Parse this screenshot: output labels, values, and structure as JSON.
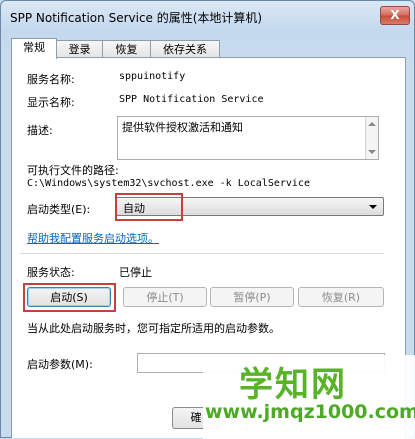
{
  "window": {
    "title": "SPP Notification Service 的属性(本地计算机)",
    "close_label": "X"
  },
  "tabs": [
    {
      "label": "常规",
      "active": true
    },
    {
      "label": "登录",
      "active": false
    },
    {
      "label": "恢复",
      "active": false
    },
    {
      "label": "依存关系",
      "active": false
    }
  ],
  "general": {
    "service_name_label": "服务名称:",
    "service_name_value": "sppuinotify",
    "display_name_label": "显示名称:",
    "display_name_value": "SPP Notification Service",
    "description_label": "描述:",
    "description_value": "提供软件授权激活和通知",
    "path_label": "可执行文件的路径:",
    "path_value": "C:\\Windows\\system32\\svchost.exe -k LocalService",
    "startup_type_label": "启动类型(E):",
    "startup_type_value": "自动",
    "help_link": "帮助我配置服务启动选项。",
    "status_label": "服务状态:",
    "status_value": "已停止",
    "buttons": {
      "start": "启动(S)",
      "stop": "停止(T)",
      "pause": "暂停(P)",
      "resume": "恢复(R)"
    },
    "hint": "当从此处启动服务时，您可指定所适用的启动参数。",
    "params_label": "启动参数(M):",
    "params_value": ""
  },
  "dialog_buttons": {
    "ok_partial": "確"
  },
  "watermark": {
    "brand": "学知网",
    "url": "www.jmqz1000.com"
  },
  "colors": {
    "highlight_box": "#c6413c",
    "link": "#0066cc",
    "watermark_green": "#58b327"
  }
}
